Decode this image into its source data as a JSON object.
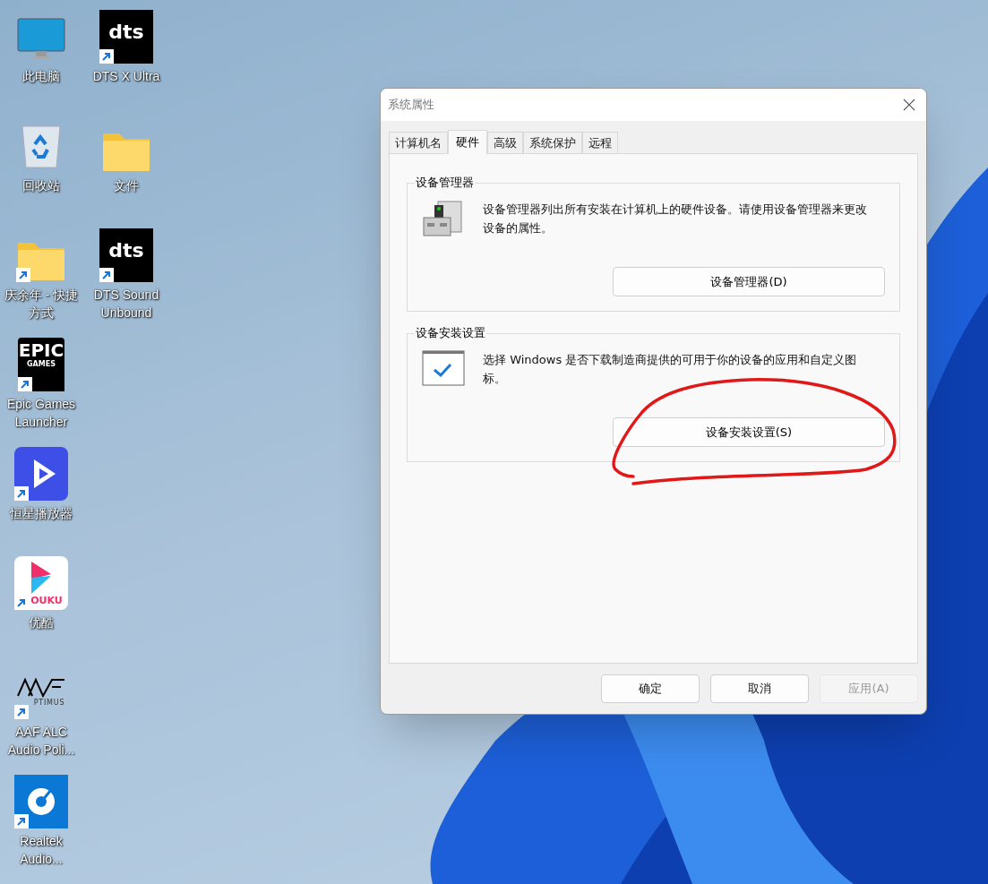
{
  "desktop_columns": [
    {
      "icons": [
        {
          "label": "此电脑",
          "kind": "monitor",
          "shortcut": false
        },
        {
          "label": "回收站",
          "kind": "recycle",
          "shortcut": false
        },
        {
          "label": "庆余年 - 快捷方式",
          "kind": "folder",
          "shortcut": true
        },
        {
          "label": "Epic Games Launcher",
          "kind": "epic",
          "logo_text": "EPIC",
          "logo_subtext": "GAMES",
          "shortcut": true
        },
        {
          "label": "恒星播放器",
          "kind": "player",
          "shortcut": true
        },
        {
          "label": "优酷",
          "kind": "youku",
          "logo_text": "OUKU",
          "shortcut": true
        },
        {
          "label": "AAF ALC Audio Poli...",
          "kind": "aaf",
          "logo_text": "PTIMUS",
          "shortcut": true
        },
        {
          "label": "Realtek Audio...",
          "kind": "realtek",
          "shortcut": true
        }
      ]
    },
    {
      "icons": [
        {
          "label": "DTS X Ultra",
          "kind": "dts",
          "logo_text": "dts",
          "shortcut": true
        },
        {
          "label": "文件",
          "kind": "folder",
          "shortcut": false
        },
        {
          "label": "DTS Sound Unbound",
          "kind": "dts",
          "logo_text": "dts",
          "shortcut": true
        }
      ]
    }
  ],
  "dialog": {
    "title": "系统属性",
    "tabs": [
      {
        "label": "计算机名",
        "selected": false
      },
      {
        "label": "硬件",
        "selected": true
      },
      {
        "label": "高级",
        "selected": false
      },
      {
        "label": "系统保护",
        "selected": false
      },
      {
        "label": "远程",
        "selected": false
      }
    ],
    "groups": [
      {
        "title": "设备管理器",
        "kind": "device",
        "description": "设备管理器列出所有安装在计算机上的硬件设备。请使用设备管理器来更改设备的属性。",
        "button": "设备管理器(D)",
        "circled": false
      },
      {
        "title": "设备安装设置",
        "kind": "install",
        "description": "选择 Windows 是否下载制造商提供的可用于你的设备的应用和自定义图标。",
        "button": "设备安装设置(S)",
        "circled": true
      }
    ],
    "buttons": [
      {
        "label": "确定",
        "disabled": false
      },
      {
        "label": "取消",
        "disabled": false
      },
      {
        "label": "应用(A)",
        "disabled": true
      }
    ]
  }
}
